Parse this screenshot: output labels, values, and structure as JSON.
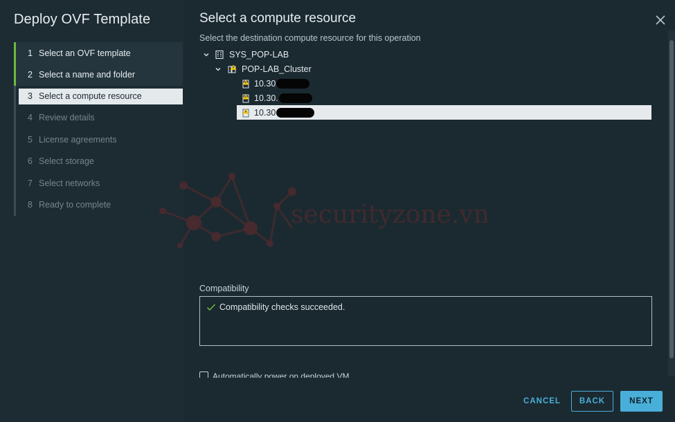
{
  "wizard": {
    "title": "Deploy OVF Template",
    "steps": [
      {
        "num": "1",
        "label": "Select an OVF template",
        "state": "done"
      },
      {
        "num": "2",
        "label": "Select a name and folder",
        "state": "done"
      },
      {
        "num": "3",
        "label": "Select a compute resource",
        "state": "active"
      },
      {
        "num": "4",
        "label": "Review details",
        "state": "pending"
      },
      {
        "num": "5",
        "label": "License agreements",
        "state": "pending"
      },
      {
        "num": "6",
        "label": "Select storage",
        "state": "pending"
      },
      {
        "num": "7",
        "label": "Select networks",
        "state": "pending"
      },
      {
        "num": "8",
        "label": "Ready to complete",
        "state": "pending"
      }
    ]
  },
  "main": {
    "title": "Select a compute resource",
    "subtitle": "Select the destination compute resource for this operation",
    "close_icon": "close-icon",
    "tree": {
      "datacenter": {
        "label": "SYS_POP-LAB",
        "icon": "datacenter-icon"
      },
      "cluster": {
        "label": "POP-LAB_Cluster",
        "icon": "cluster-warning-icon"
      },
      "hosts": [
        {
          "label": "10.30",
          "icon": "host-warning-icon",
          "selected": false
        },
        {
          "label": "10.30.",
          "icon": "host-warning-icon",
          "selected": false
        },
        {
          "label": "10.30",
          "icon": "host-warning-icon",
          "selected": true
        }
      ]
    },
    "watermark": "securityzone.vn",
    "compatibility": {
      "label": "Compatibility",
      "message": "Compatibility checks succeeded.",
      "status_icon": "check-icon"
    },
    "power_on": {
      "label": "Automatically power on deployed VM",
      "checked": false
    }
  },
  "footer": {
    "cancel_label": "CANCEL",
    "back_label": "BACK",
    "next_label": "NEXT"
  },
  "colors": {
    "accent": "#49afd9",
    "done_marker": "#6fb93f",
    "warning": "#f5c710"
  }
}
